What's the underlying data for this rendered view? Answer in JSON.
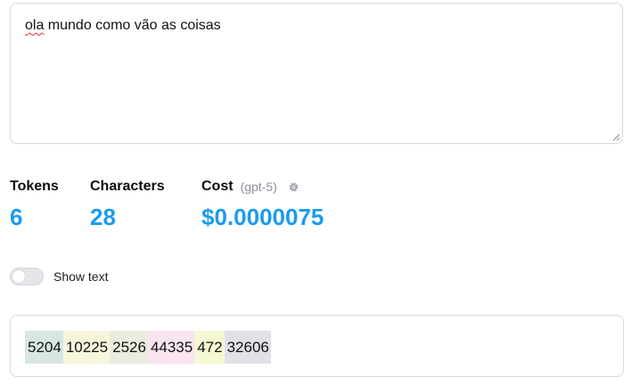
{
  "input": {
    "misspelled_word": "ola",
    "rest_text": " mundo como vão as coisas"
  },
  "stats": {
    "tokens_label": "Tokens",
    "tokens_value": "6",
    "characters_label": "Characters",
    "characters_value": "28",
    "cost_label": "Cost",
    "cost_model": "(gpt-5)",
    "cost_value": "$0.0000075",
    "settings_icon": "gear-icon"
  },
  "toggle": {
    "label": "Show text",
    "checked": false
  },
  "tokens": [
    {
      "id": "5204",
      "color": "#d7e6e2"
    },
    {
      "id": "10225",
      "color": "#f7f6dc"
    },
    {
      "id": "2526",
      "color": "#e9ecdf"
    },
    {
      "id": "44335",
      "color": "#f9e4f1"
    },
    {
      "id": "472",
      "color": "#f5f8d3"
    },
    {
      "id": "32606",
      "color": "#dfe1e6"
    }
  ],
  "colors": {
    "accent": "#1a9bef",
    "border": "#d9d9de",
    "muted": "#8e8ea0"
  }
}
